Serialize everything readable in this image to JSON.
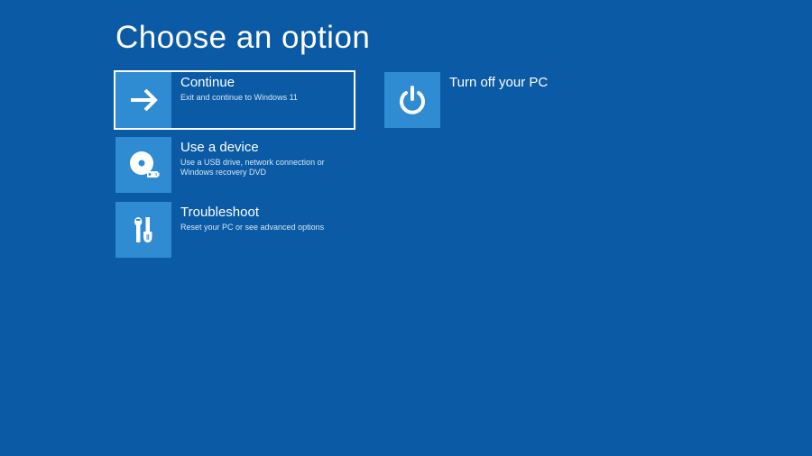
{
  "title": "Choose an option",
  "options": {
    "continue": {
      "title": "Continue",
      "desc": "Exit and continue to Windows 11"
    },
    "device": {
      "title": "Use a device",
      "desc": "Use a USB drive, network connection or Windows recovery DVD"
    },
    "troubleshoot": {
      "title": "Troubleshoot",
      "desc": "Reset your PC or see advanced options"
    },
    "turnoff": {
      "title": "Turn off your PC",
      "desc": ""
    }
  }
}
